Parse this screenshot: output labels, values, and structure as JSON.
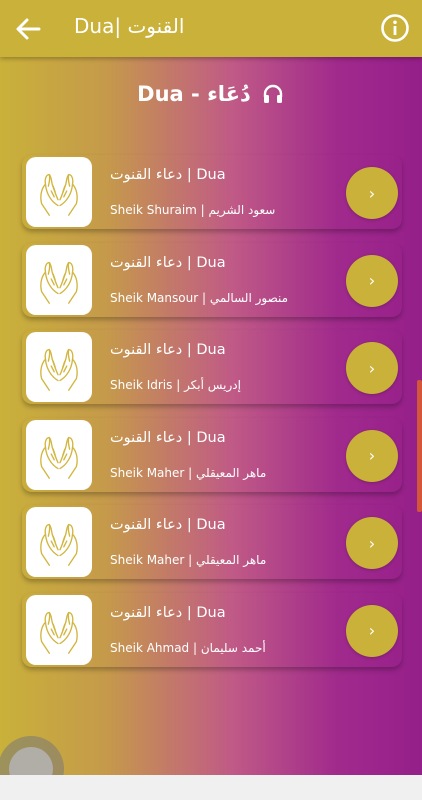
{
  "header": {
    "title": "Dua| القنوت",
    "back_icon": "arrow-left-icon",
    "info_icon": "info-circle-icon",
    "color": "#c9b13a"
  },
  "section": {
    "title": "Dua - دُعَاء",
    "icon": "headphones-icon"
  },
  "items": [
    {
      "title": "دعاء القنوت | Dua",
      "reciter": "Sheik Shuraim | سعود الشريم",
      "icon": "praying-hands-icon"
    },
    {
      "title": "دعاء القنوت | Dua",
      "reciter": "Sheik Mansour | منصور السالمي",
      "icon": "praying-hands-icon"
    },
    {
      "title": "دعاء القنوت | Dua",
      "reciter": "Sheik Idris | إدريس أبكر",
      "icon": "praying-hands-icon"
    },
    {
      "title": "دعاء القنوت | Dua",
      "reciter": "Sheik Maher | ماهر المعيقلي",
      "icon": "praying-hands-icon"
    },
    {
      "title": "دعاء القنوت | Dua",
      "reciter": "Sheik Maher | ماهر المعيقلي",
      "icon": "praying-hands-icon"
    },
    {
      "title": "دعاء القنوت | Dua",
      "reciter": "Sheik Ahmad | أحمد سليمان",
      "icon": "praying-hands-icon"
    }
  ],
  "play_button_glyph": "›",
  "colors": {
    "accent": "#c9b13a",
    "gradient_end": "#951f8a"
  }
}
